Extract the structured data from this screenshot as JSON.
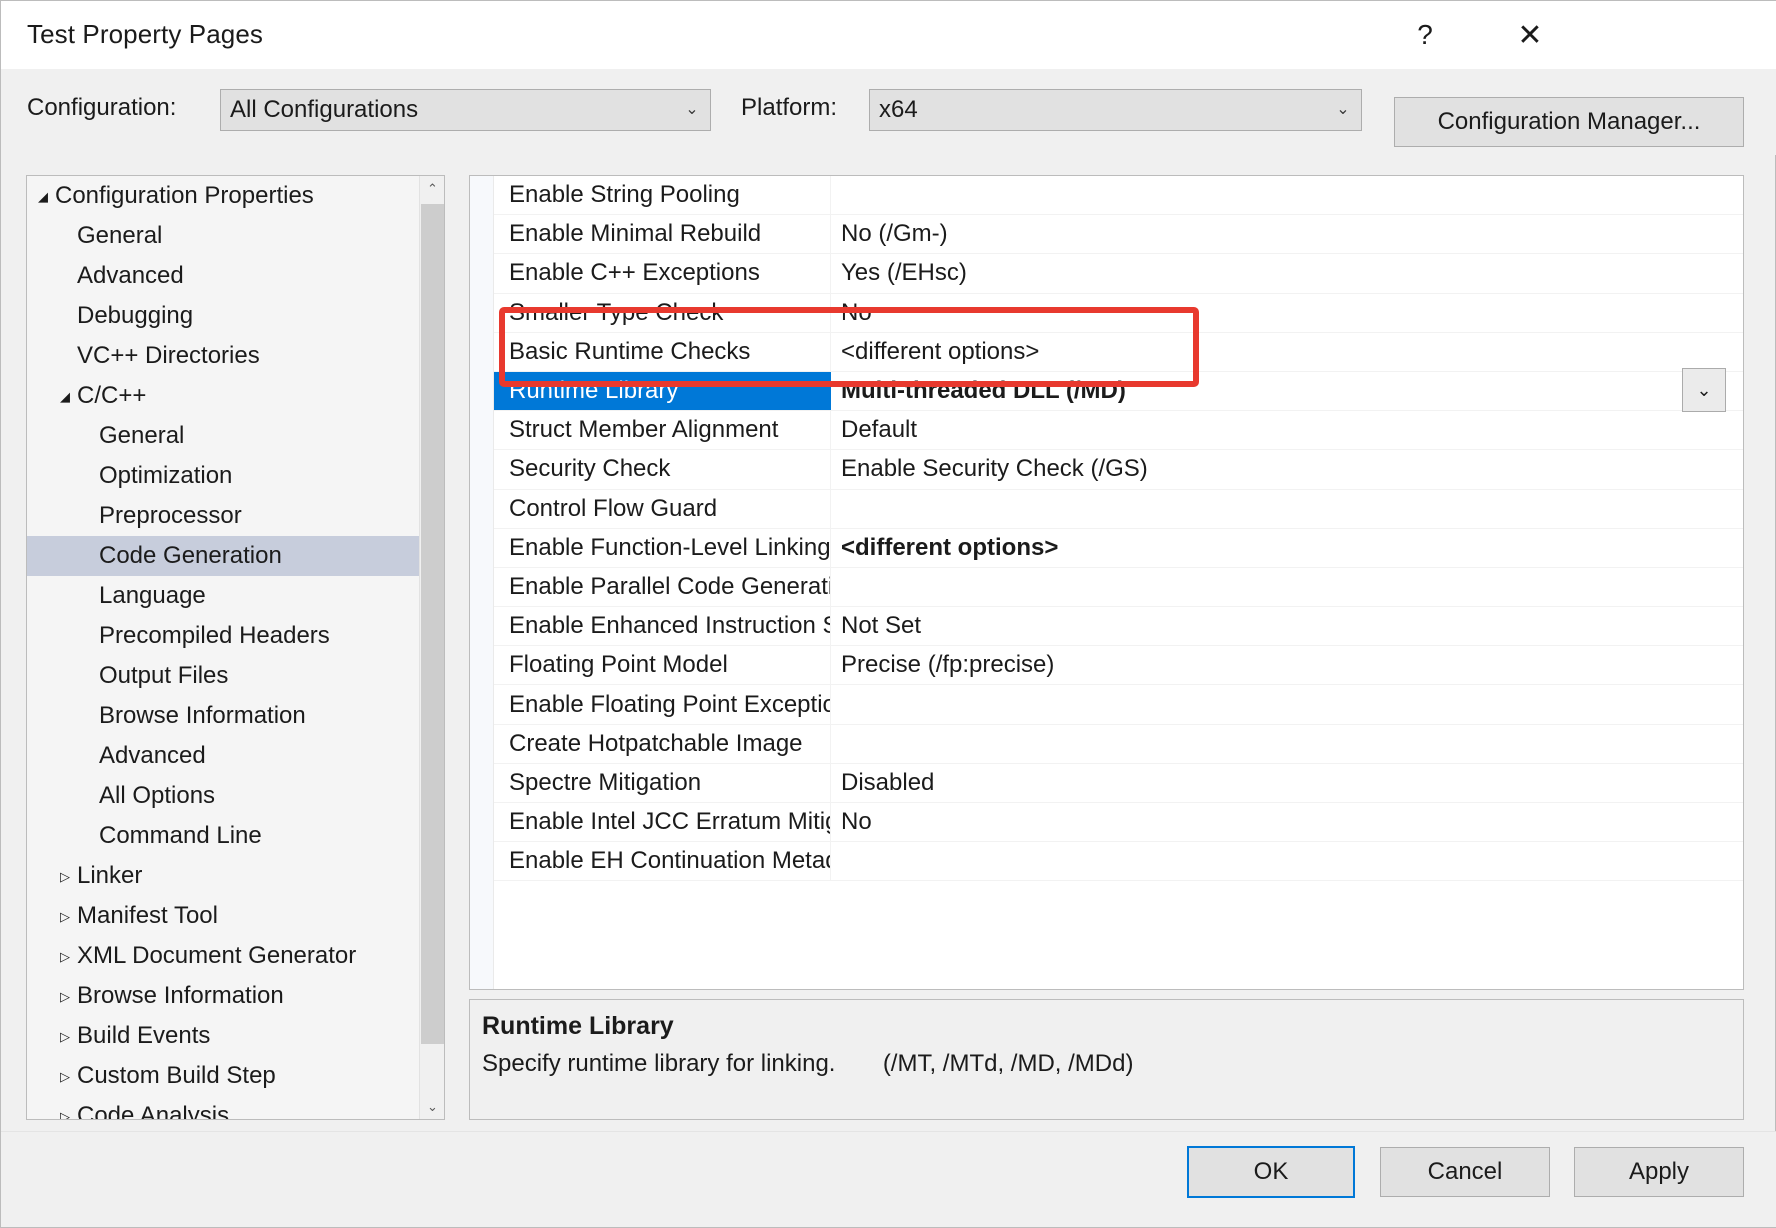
{
  "window": {
    "title": "Test Property Pages",
    "help_icon": "?",
    "close_icon": "✕"
  },
  "config_bar": {
    "configuration_label": "Configuration:",
    "configuration_value": "All Configurations",
    "platform_label": "Platform:",
    "platform_value": "x64",
    "configuration_manager_label": "Configuration Manager...",
    "dropdown_icon": "⌄"
  },
  "tree": {
    "scroll_up_icon": "⌃",
    "scroll_down_icon": "⌄",
    "expanded_icon": "◢",
    "collapsed_icon": "▷",
    "items": [
      {
        "label": "Configuration Properties",
        "level": 0,
        "state": "expanded",
        "selected": false
      },
      {
        "label": "General",
        "level": 1,
        "state": "leaf",
        "selected": false
      },
      {
        "label": "Advanced",
        "level": 1,
        "state": "leaf",
        "selected": false
      },
      {
        "label": "Debugging",
        "level": 1,
        "state": "leaf",
        "selected": false
      },
      {
        "label": "VC++ Directories",
        "level": 1,
        "state": "leaf",
        "selected": false
      },
      {
        "label": "C/C++",
        "level": 1,
        "state": "expanded",
        "selected": false
      },
      {
        "label": "General",
        "level": 2,
        "state": "leaf",
        "selected": false
      },
      {
        "label": "Optimization",
        "level": 2,
        "state": "leaf",
        "selected": false
      },
      {
        "label": "Preprocessor",
        "level": 2,
        "state": "leaf",
        "selected": false
      },
      {
        "label": "Code Generation",
        "level": 2,
        "state": "leaf",
        "selected": true
      },
      {
        "label": "Language",
        "level": 2,
        "state": "leaf",
        "selected": false
      },
      {
        "label": "Precompiled Headers",
        "level": 2,
        "state": "leaf",
        "selected": false
      },
      {
        "label": "Output Files",
        "level": 2,
        "state": "leaf",
        "selected": false
      },
      {
        "label": "Browse Information",
        "level": 2,
        "state": "leaf",
        "selected": false
      },
      {
        "label": "Advanced",
        "level": 2,
        "state": "leaf",
        "selected": false
      },
      {
        "label": "All Options",
        "level": 2,
        "state": "leaf",
        "selected": false
      },
      {
        "label": "Command Line",
        "level": 2,
        "state": "leaf",
        "selected": false
      },
      {
        "label": "Linker",
        "level": 1,
        "state": "collapsed",
        "selected": false
      },
      {
        "label": "Manifest Tool",
        "level": 1,
        "state": "collapsed",
        "selected": false
      },
      {
        "label": "XML Document Generator",
        "level": 1,
        "state": "collapsed",
        "selected": false
      },
      {
        "label": "Browse Information",
        "level": 1,
        "state": "collapsed",
        "selected": false
      },
      {
        "label": "Build Events",
        "level": 1,
        "state": "collapsed",
        "selected": false
      },
      {
        "label": "Custom Build Step",
        "level": 1,
        "state": "collapsed",
        "selected": false
      },
      {
        "label": "Code Analysis",
        "level": 1,
        "state": "collapsed",
        "selected": false
      }
    ]
  },
  "grid": {
    "dropdown_icon": "⌄",
    "rows": [
      {
        "name": "Enable String Pooling",
        "value": "",
        "bold": false,
        "selected": false
      },
      {
        "name": "Enable Minimal Rebuild",
        "value": "No (/Gm-)",
        "bold": false,
        "selected": false
      },
      {
        "name": "Enable C++ Exceptions",
        "value": "Yes (/EHsc)",
        "bold": false,
        "selected": false
      },
      {
        "name": "Smaller Type Check",
        "value": "No",
        "bold": false,
        "selected": false
      },
      {
        "name": "Basic Runtime Checks",
        "value": "<different options>",
        "bold": false,
        "selected": false
      },
      {
        "name": "Runtime Library",
        "value": "Multi-threaded DLL (/MD)",
        "bold": true,
        "selected": true
      },
      {
        "name": "Struct Member Alignment",
        "value": "Default",
        "bold": false,
        "selected": false
      },
      {
        "name": "Security Check",
        "value": "Enable Security Check (/GS)",
        "bold": false,
        "selected": false
      },
      {
        "name": "Control Flow Guard",
        "value": "",
        "bold": false,
        "selected": false
      },
      {
        "name": "Enable Function-Level Linking",
        "value": "<different options>",
        "bold": true,
        "selected": false
      },
      {
        "name": "Enable Parallel Code Generation",
        "value": "",
        "bold": false,
        "selected": false
      },
      {
        "name": "Enable Enhanced Instruction Set",
        "value": "Not Set",
        "bold": false,
        "selected": false
      },
      {
        "name": "Floating Point Model",
        "value": "Precise (/fp:precise)",
        "bold": false,
        "selected": false
      },
      {
        "name": "Enable Floating Point Exceptions",
        "value": "",
        "bold": false,
        "selected": false
      },
      {
        "name": "Create Hotpatchable Image",
        "value": "",
        "bold": false,
        "selected": false
      },
      {
        "name": "Spectre Mitigation",
        "value": "Disabled",
        "bold": false,
        "selected": false
      },
      {
        "name": "Enable Intel JCC Erratum Mitigation",
        "value": "No",
        "bold": false,
        "selected": false
      },
      {
        "name": "Enable EH Continuation Metadata",
        "value": "",
        "bold": false,
        "selected": false
      }
    ]
  },
  "description": {
    "title": "Runtime Library",
    "text": "Specify runtime library for linking.",
    "switches": "(/MT, /MTd, /MD, /MDd)"
  },
  "footer": {
    "ok_label": "OK",
    "cancel_label": "Cancel",
    "apply_label": "Apply"
  },
  "colors": {
    "selection_blue": "#0078d7",
    "tree_selection": "#c7cddc",
    "annotation_red": "#e8392e",
    "dialog_bg": "#f0f0f0"
  }
}
